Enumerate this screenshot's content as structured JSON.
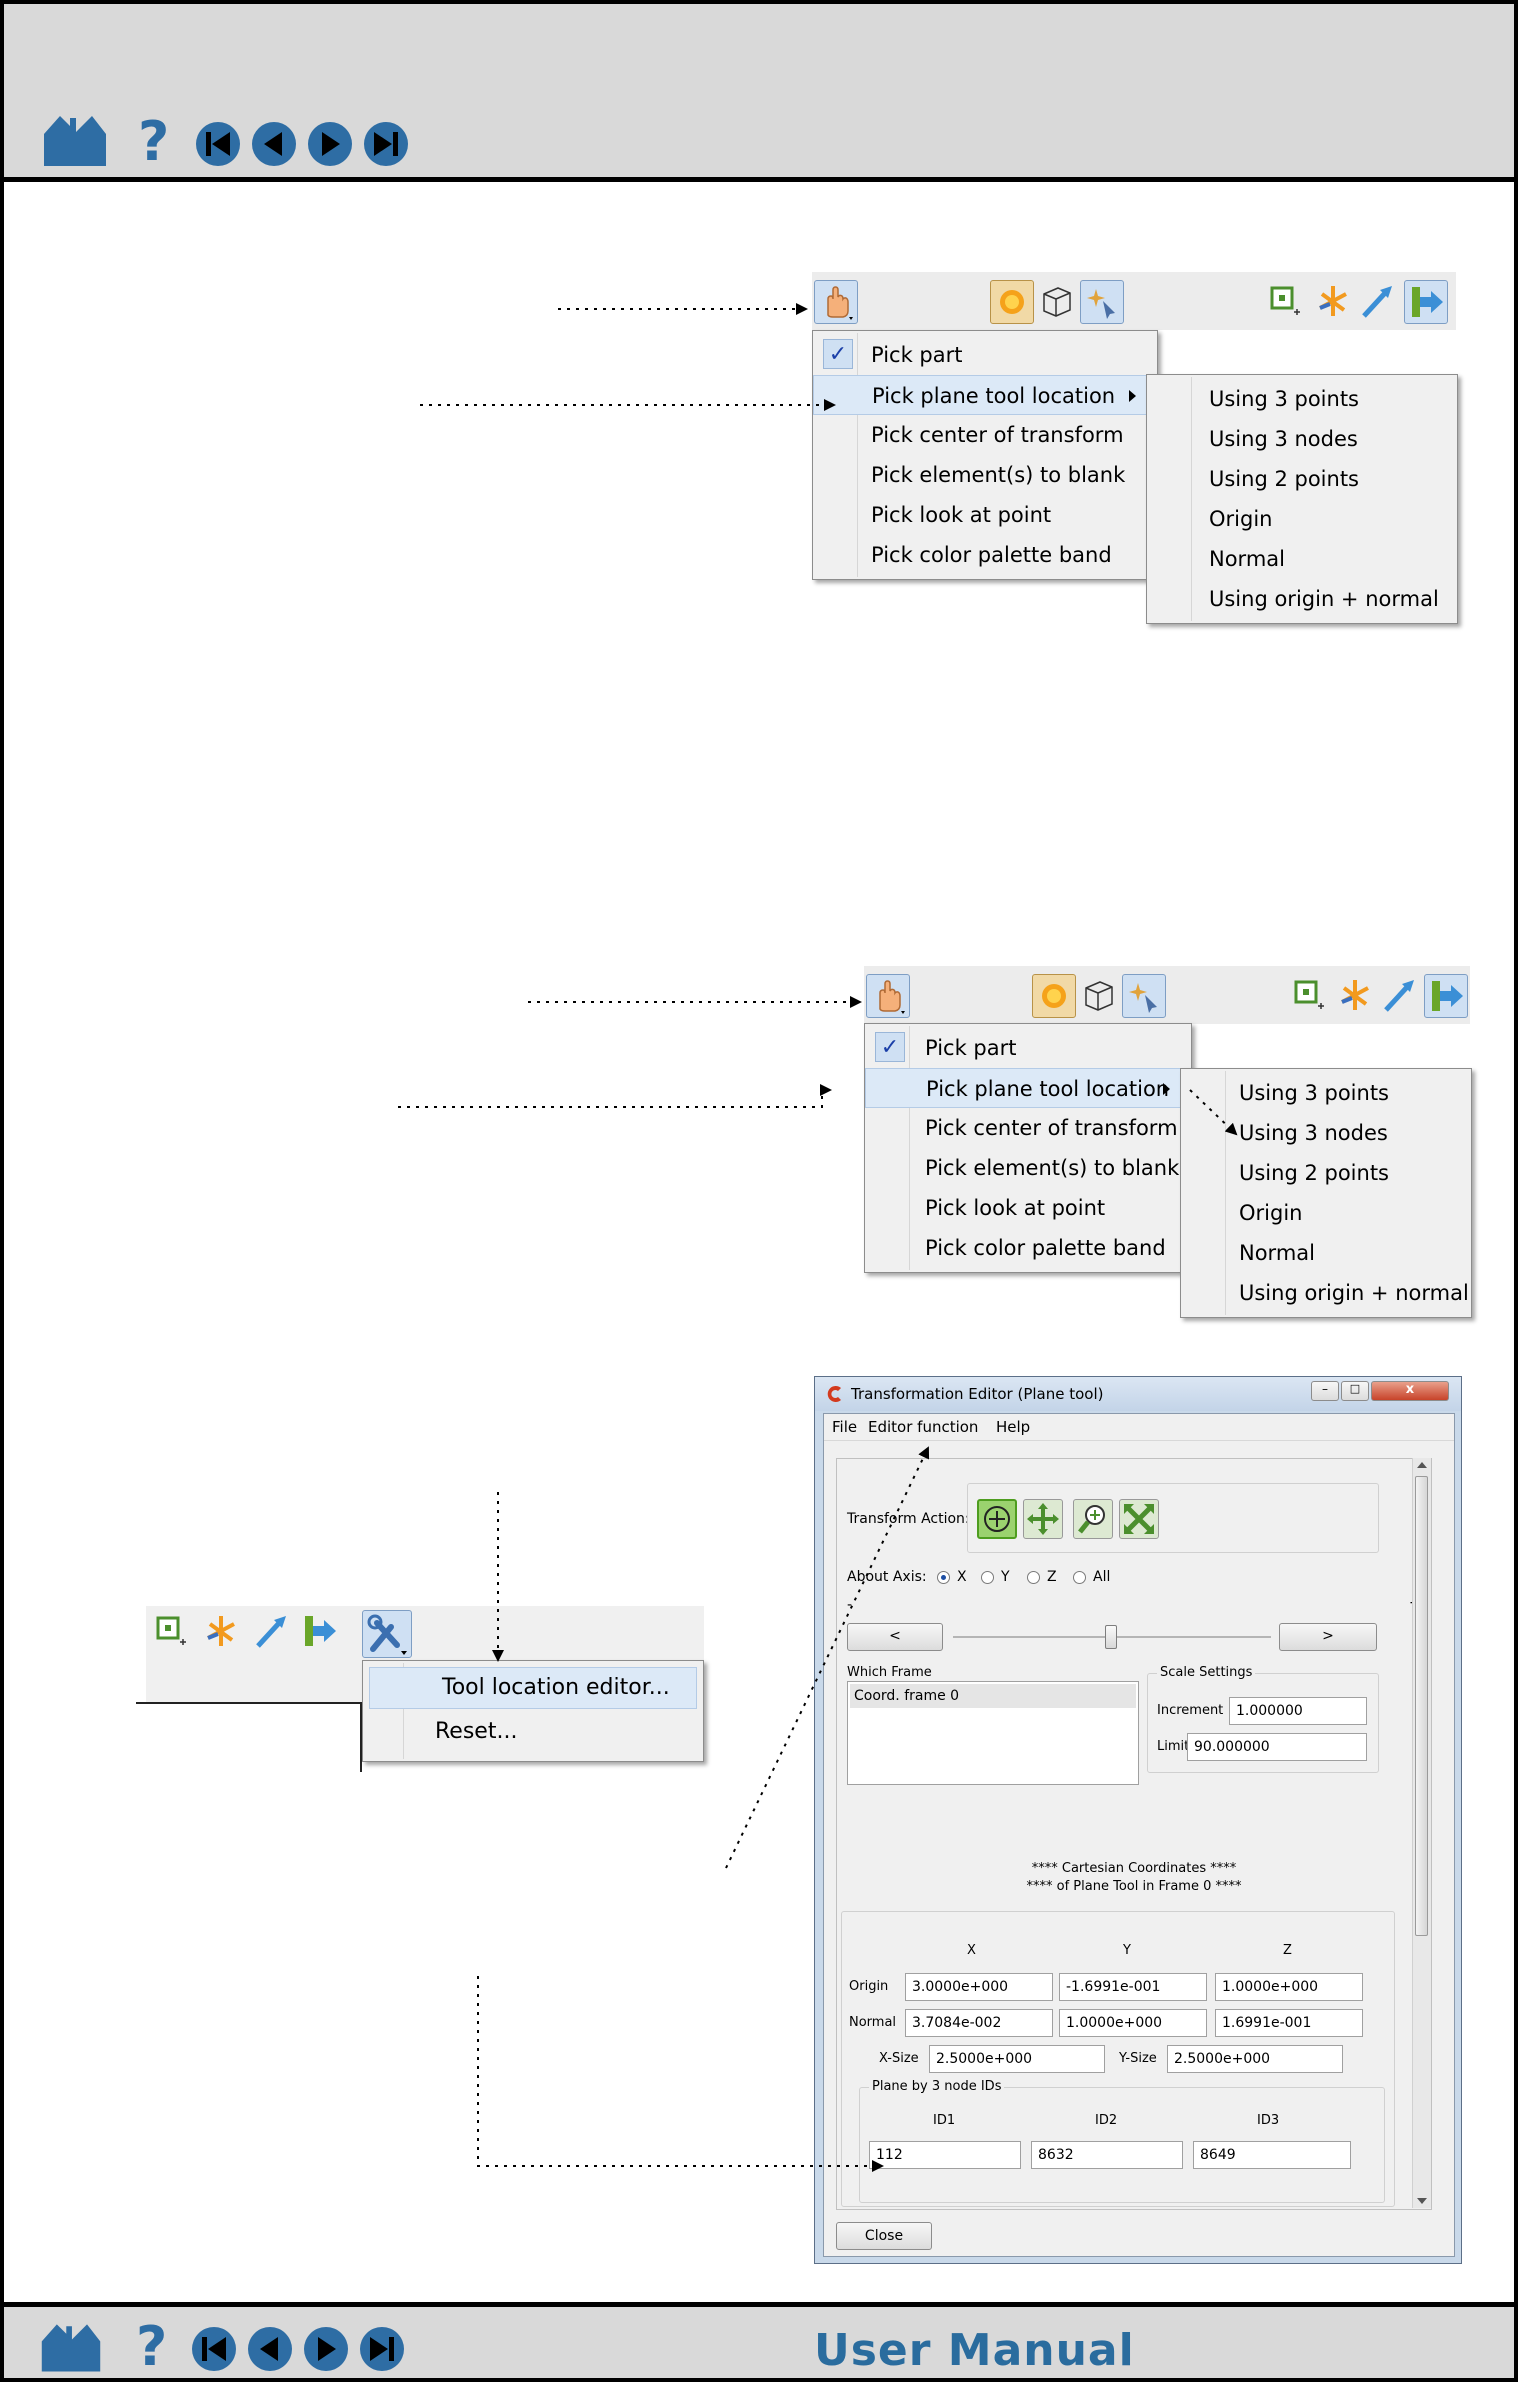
{
  "footer": {
    "title": "User Manual"
  },
  "pick_menu": {
    "items": [
      {
        "label": "Pick part"
      },
      {
        "label": "Pick plane tool location"
      },
      {
        "label": "Pick center of transform"
      },
      {
        "label": "Pick element(s) to blank"
      },
      {
        "label": "Pick look at point"
      },
      {
        "label": "Pick color palette band"
      }
    ]
  },
  "plane_submenu": {
    "items": [
      {
        "label": "Using 3 points"
      },
      {
        "label": "Using 3 nodes"
      },
      {
        "label": "Using 2 points"
      },
      {
        "label": "Origin"
      },
      {
        "label": "Normal"
      },
      {
        "label": "Using origin + normal"
      }
    ]
  },
  "tool_menu": {
    "items": [
      {
        "label": "Tool location editor..."
      },
      {
        "label": "Reset..."
      }
    ]
  },
  "editor": {
    "title": "Transformation Editor (Plane tool)",
    "menubar": [
      "File",
      "Editor function",
      "Help"
    ],
    "transform_action_label": "Transform Action:",
    "about_axis_label": "About Axis:",
    "axis_options": [
      "X",
      "Y",
      "Z",
      "All"
    ],
    "axis_selected": "X",
    "slider_minus": "-",
    "slider_plus": "+",
    "left_button": "<",
    "right_button": ">",
    "which_frame_label": "Which Frame",
    "frames": [
      "Coord. frame 0"
    ],
    "scale_settings_label": "Scale Settings",
    "increment_label": "Increment",
    "increment_value": "1.000000",
    "limit_label": "Limit",
    "limit_value": "90.000000",
    "coords_heading_1": "**** Cartesian Coordinates ****",
    "coords_heading_2": "**** of Plane Tool in Frame 0 ****",
    "col_x": "X",
    "col_y": "Y",
    "col_z": "Z",
    "origin_label": "Origin",
    "origin": [
      "3.0000e+000",
      "-1.6991e-001",
      "1.0000e+000"
    ],
    "normal_label": "Normal",
    "normal": [
      "3.7084e-002",
      "1.0000e+000",
      "1.6991e-001"
    ],
    "xsize_label": "X-Size",
    "xsize": "2.5000e+000",
    "ysize_label": "Y-Size",
    "ysize": "2.5000e+000",
    "node_group_label": "Plane by 3 node IDs",
    "id_labels": [
      "ID1",
      "ID2",
      "ID3"
    ],
    "ids": [
      "112",
      "8632",
      "8649"
    ],
    "close_button": "Close"
  }
}
